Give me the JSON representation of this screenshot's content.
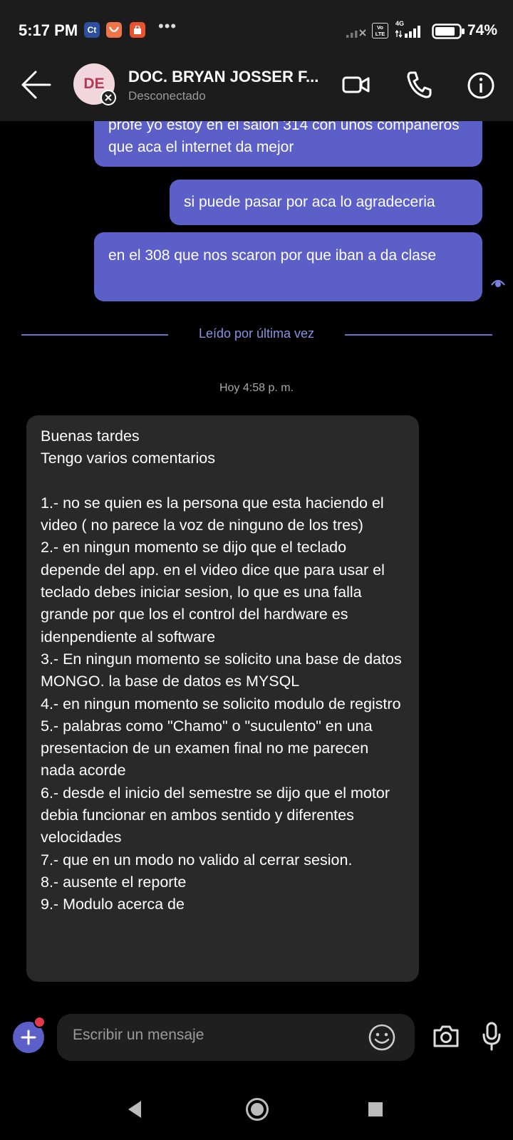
{
  "status_bar": {
    "time": "5:17 PM",
    "battery": "74%",
    "network": "4G",
    "volte": "Vo LTE",
    "overflow": "•••",
    "icons": [
      "ct-app-icon",
      "app-icon",
      "store-icon"
    ]
  },
  "header": {
    "avatar_initials": "DE",
    "contact_name": "DOC. BRYAN JOSSER F...",
    "status": "Desconectado"
  },
  "messages_sent": [
    {
      "text": "profe yo estoy en el salon 314 con unos compañeros que aca el internet da mejor"
    },
    {
      "text": "si puede pasar por aca lo agradeceria"
    },
    {
      "text": "en el 308 que nos scaron por que iban a da clase"
    }
  ],
  "read_marker": "Leído por última vez",
  "date_separator": "Hoy 4:58 p. m.",
  "received_message": {
    "text": "Buenas tardes\nTengo varios comentarios\n\n1.- no se quien es la persona que esta haciendo el video ( no parece la voz de ninguno de los tres)\n2.- en ningun momento se dijo que el teclado depende del app. en el video dice que para usar el teclado debes iniciar sesion, lo que es una falla grande por que los el control del hardware es idenpendiente al software\n3.- En ningun momento se solicito una base de datos MONGO. la base de datos es MYSQL\n4.- en ningun momento se solicito modulo de registro\n5.- palabras como \"Chamo\" o \"suculento\" en una presentacion de un examen final no me parecen nada acorde\n6.- desde el inicio del semestre se dijo que el motor debia funcionar en ambos sentido y diferentes velocidades\n7.- que en un modo no valido al cerrar sesion.\n8.- ausente el reporte\n9.- Modulo acerca de"
  },
  "composer": {
    "placeholder": "Escribir un mensaje"
  },
  "colors": {
    "accent": "#5b5fc7",
    "header_bg": "#1c1c1c",
    "received_bubble": "#292929",
    "notification_dot": "#e23a4b"
  }
}
